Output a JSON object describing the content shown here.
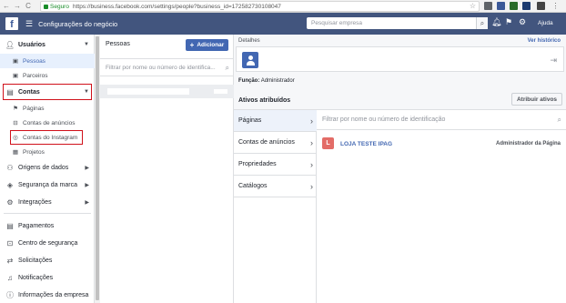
{
  "browser": {
    "back": "←",
    "forward": "→",
    "reload": "C",
    "secure_label": "Seguro",
    "url": "https://business.facebook.com/settings/people?business_id=172582730108047",
    "star": "☆"
  },
  "topbar": {
    "logo": "f",
    "menu_icon": "☰",
    "title": "Configurações do negócio",
    "search_placeholder": "Pesquisar empresa",
    "help_label": "Ajuda"
  },
  "sidebar": {
    "usuarios": "Usuários",
    "pessoas": "Pessoas",
    "parceiros": "Parceiros",
    "contas": "Contas",
    "paginas": "Páginas",
    "contas_anuncios": "Contas de anúncios",
    "contas_instagram": "Contas do Instagram",
    "projetos": "Projetos",
    "origens": "Origens de dados",
    "seguranca_marca": "Segurança da marca",
    "integracoes": "Integrações",
    "pagamentos": "Pagamentos",
    "centro_seguranca": "Centro de segurança",
    "solicitacoes": "Solicitações",
    "notificacoes": "Notificações",
    "info_empresa": "Informações da empresa"
  },
  "people": {
    "heading": "Pessoas",
    "add_label": "Adicionar",
    "filter_placeholder": "Filtrar por nome ou número de identifica..."
  },
  "details": {
    "label": "Detalhes",
    "history": "Ver histórico",
    "role_label": "Função:",
    "role_value": "Administrador",
    "assets_title": "Ativos atribuídos",
    "assign_button": "Atribuir ativos",
    "asset_types": [
      "Páginas",
      "Contas de anúncios",
      "Propriedades",
      "Catálogos"
    ],
    "asset_filter_placeholder": "Filtrar por nome ou número de identificação",
    "page": {
      "initial": "L",
      "name": "LOJA TESTE IPAG",
      "role": "Administrador da Página"
    }
  },
  "colors": {
    "brand": "#4267b2",
    "topbar": "#42557e",
    "highlight": "#d0101a"
  }
}
